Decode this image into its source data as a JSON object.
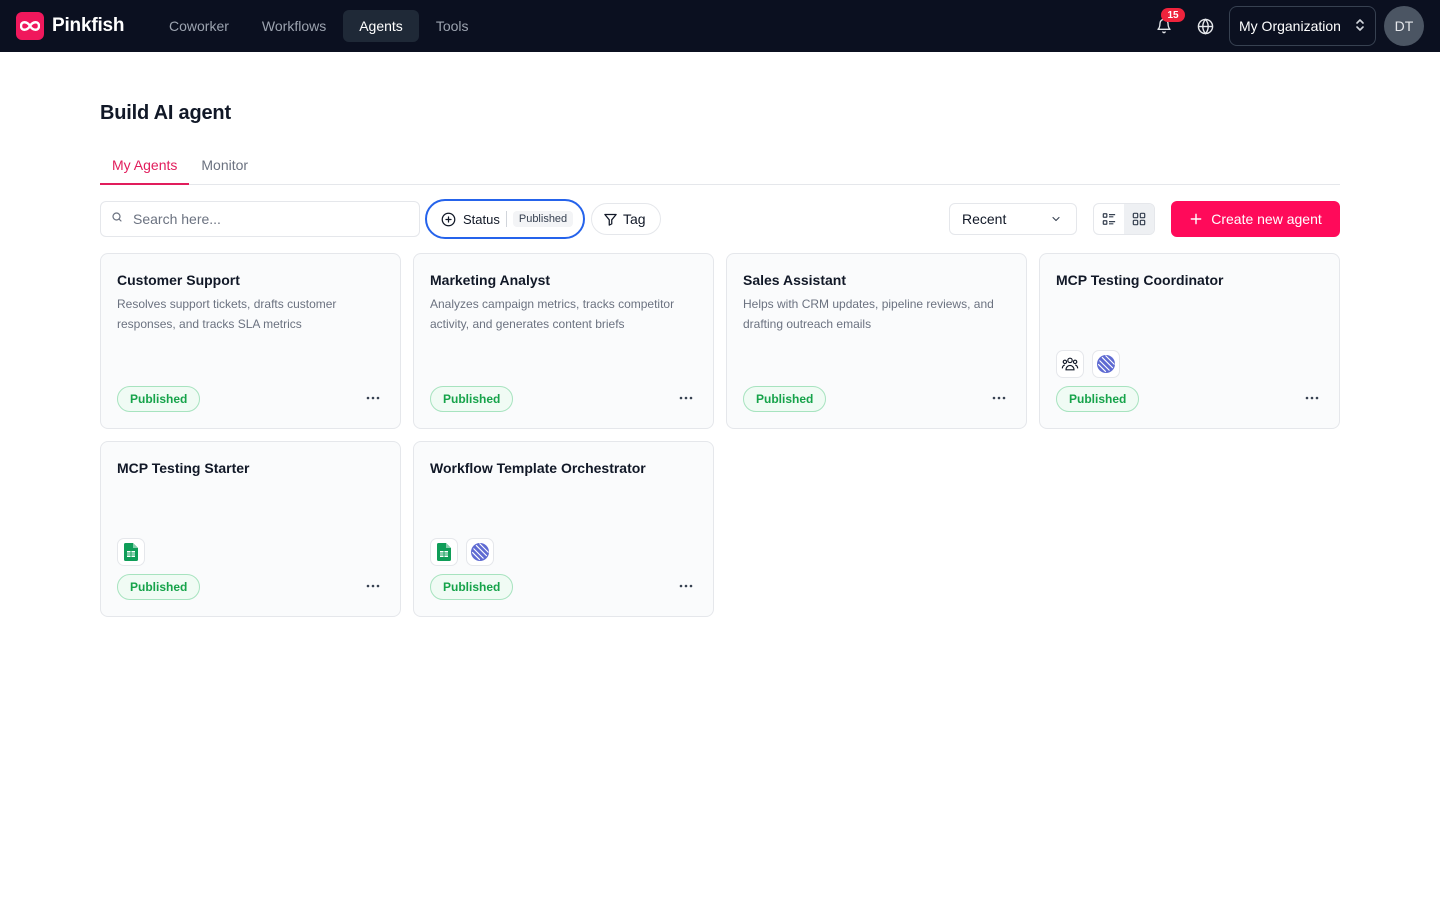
{
  "brand": {
    "name": "Pinkfish",
    "accent": "#f0185c"
  },
  "nav": {
    "items": [
      "Coworker",
      "Workflows",
      "Agents",
      "Tools"
    ],
    "active": "Agents"
  },
  "header": {
    "notifications_count": "15",
    "org_label": "My Organization",
    "avatar_initials": "DT"
  },
  "page": {
    "title": "Build AI agent"
  },
  "tabs": [
    {
      "label": "My Agents",
      "active": true
    },
    {
      "label": "Monitor",
      "active": false
    }
  ],
  "toolbar": {
    "search_placeholder": "Search here...",
    "status_label": "Status",
    "status_value": "Published",
    "tag_label": "Tag",
    "sort_value": "Recent",
    "view_mode": "grid",
    "create_label": "Create new agent"
  },
  "agents": [
    {
      "title": "Customer Support",
      "description": "Resolves support tickets, drafts customer responses, and tracks SLA metrics",
      "status": "Published",
      "icons": []
    },
    {
      "title": "Marketing Analyst",
      "description": "Analyzes campaign metrics, tracks competitor activity, and generates content briefs",
      "status": "Published",
      "icons": []
    },
    {
      "title": "Sales Assistant",
      "description": "Helps with CRM updates, pipeline reviews, and drafting outreach emails",
      "status": "Published",
      "icons": []
    },
    {
      "title": "MCP Testing Coordinator",
      "description": "",
      "status": "Published",
      "icons": [
        "team-icon",
        "linear-icon"
      ]
    },
    {
      "title": "MCP Testing Starter",
      "description": "",
      "status": "Published",
      "icons": [
        "google-sheets-icon"
      ]
    },
    {
      "title": "Workflow Template Orchestrator",
      "description": "",
      "status": "Published",
      "icons": [
        "google-sheets-icon",
        "linear-icon"
      ]
    }
  ]
}
